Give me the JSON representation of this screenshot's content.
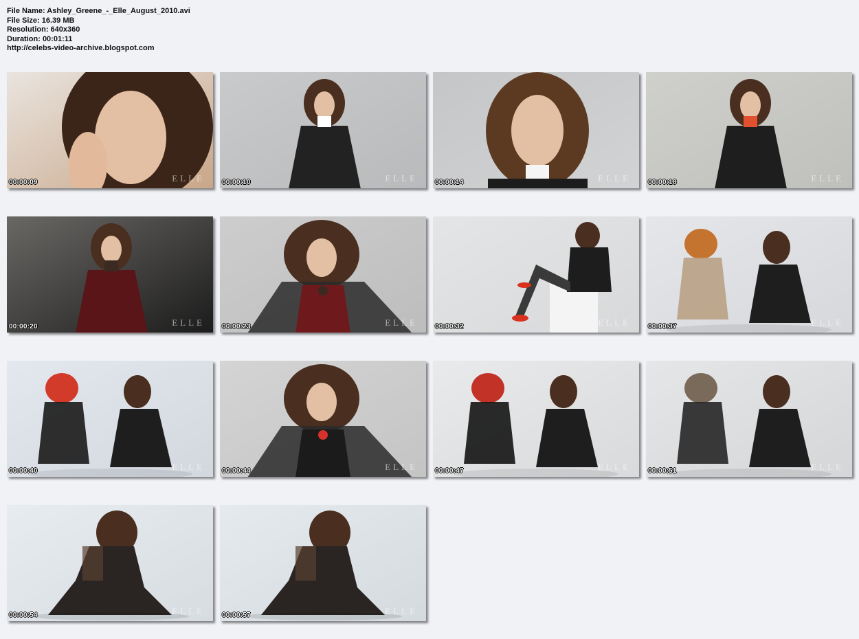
{
  "header": {
    "file_name": "File Name: Ashley_Greene_-_Elle_August_2010.avi",
    "file_size": "File Size: 16.39 MB",
    "resolution": "Resolution: 640x360",
    "duration": "Duration: 00:01:11",
    "url": "http://celebs-video-archive.blogspot.com"
  },
  "watermark": "ELLE",
  "thumbnails": [
    {
      "time": "00:00:09",
      "bg": "#e9e4df",
      "bg2": "#c9a688",
      "figure": "#3b2418",
      "accent": "#e2b99a",
      "scene": "closeup"
    },
    {
      "time": "00:00:10",
      "bg": "#c9cacb",
      "bg2": "#b9babb",
      "figure": "#222222",
      "accent": "#ffffff",
      "scene": "standing"
    },
    {
      "time": "00:00:14",
      "bg": "#c5c6c7",
      "bg2": "#d2d3d4",
      "figure": "#5c3a22",
      "accent": "#f5f5f5",
      "scene": "portrait"
    },
    {
      "time": "00:00:18",
      "bg": "#cfd0cc",
      "bg2": "#bfc0bc",
      "figure": "#1e1e1e",
      "accent": "#e2502e",
      "scene": "standing"
    },
    {
      "time": "00:00:20",
      "bg": "#6a6865",
      "bg2": "#1c1c1c",
      "figure": "#5a1518",
      "accent": "#3a2a22",
      "scene": "standing"
    },
    {
      "time": "00:00:23",
      "bg": "#cdcdcd",
      "bg2": "#bdbdbd",
      "figure": "#6e1a1d",
      "accent": "#3a2a22",
      "scene": "wide"
    },
    {
      "time": "00:00:32",
      "bg": "#e4e5e6",
      "bg2": "#d8d9da",
      "figure": "#1d1d1d",
      "accent": "#d8321e",
      "scene": "sitting"
    },
    {
      "time": "00:00:37",
      "bg": "#e4e6ea",
      "bg2": "#d6d8dc",
      "figure": "#b9a184",
      "accent": "#c4742f",
      "scene": "duo"
    },
    {
      "time": "00:00:40",
      "bg": "#e2e8ee",
      "bg2": "#d2d8de",
      "figure": "#1a1a1a",
      "accent": "#d23a2a",
      "scene": "duo"
    },
    {
      "time": "00:00:44",
      "bg": "#d4d4d4",
      "bg2": "#c4c4c4",
      "figure": "#1b1b1b",
      "accent": "#d63229",
      "scene": "wide"
    },
    {
      "time": "00:00:47",
      "bg": "#e9eaeb",
      "bg2": "#d9dadb",
      "figure": "#141414",
      "accent": "#c23226",
      "scene": "duo"
    },
    {
      "time": "00:00:51",
      "bg": "#e4e6e8",
      "bg2": "#d4d6d8",
      "figure": "#262626",
      "accent": "#7a6a5a",
      "scene": "duo"
    },
    {
      "time": "00:00:54",
      "bg": "#e6ecf0",
      "bg2": "#d6dce0",
      "figure": "#2a2522",
      "accent": "#5a4030",
      "scene": "kneel"
    },
    {
      "time": "00:00:57",
      "bg": "#e4eaee",
      "bg2": "#d4dade",
      "figure": "#2a2522",
      "accent": "#5a4030",
      "scene": "kneel"
    }
  ]
}
